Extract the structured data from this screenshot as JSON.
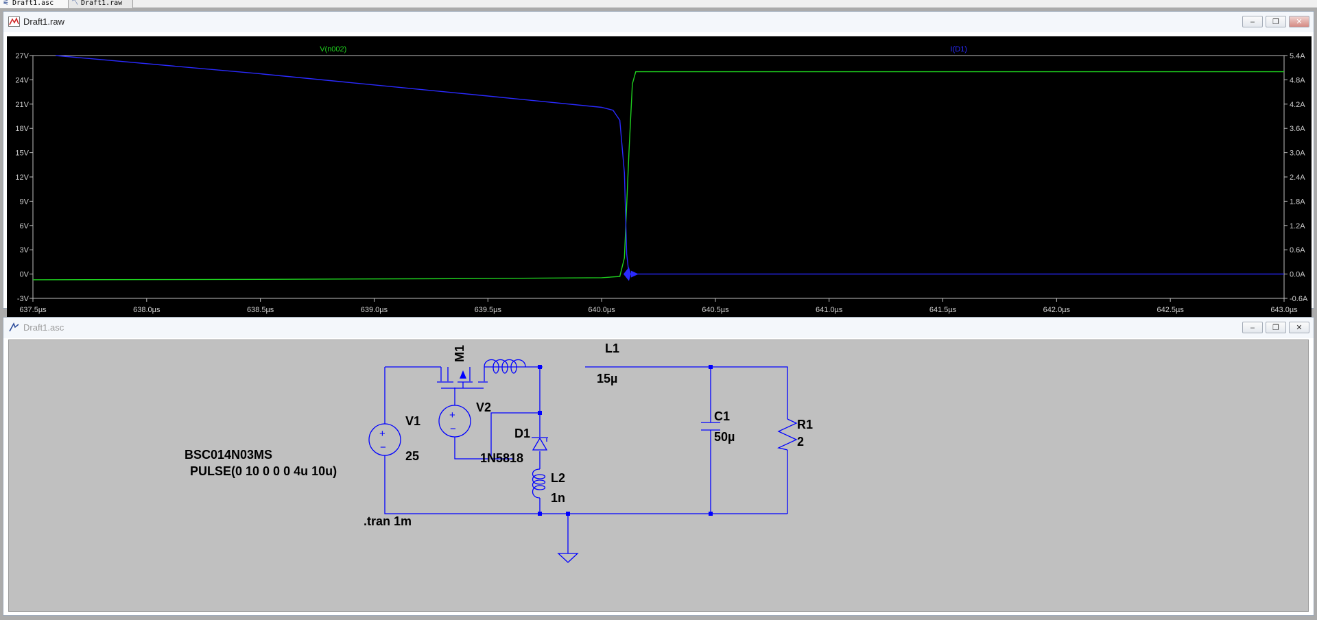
{
  "tabs": [
    {
      "label": "Draft1.asc",
      "icon": "schematic-icon"
    },
    {
      "label": "Draft1.raw",
      "icon": "waveform-icon"
    }
  ],
  "waveform_window": {
    "title": "Draft1.raw",
    "buttons": {
      "minimize": "‒",
      "restore": "❐",
      "close": "✕"
    }
  },
  "schematic_window": {
    "title": "Draft1.asc",
    "buttons": {
      "minimize": "‒",
      "restore": "❐",
      "close": "✕"
    }
  },
  "colors": {
    "plot_bg": "#000000",
    "trace_voltage": "#1fd21f",
    "trace_current": "#2a2aff",
    "wire": "#0000ff",
    "schematic_bg": "#c0c0c0"
  },
  "chart_data": {
    "type": "line",
    "x": {
      "ticks": [
        "637.5µs",
        "638.0µs",
        "638.5µs",
        "639.0µs",
        "639.5µs",
        "640.0µs",
        "640.5µs",
        "641.0µs",
        "641.5µs",
        "642.0µs",
        "642.5µs",
        "643.0µs"
      ],
      "tick_values": [
        637.5,
        638.0,
        638.5,
        639.0,
        639.5,
        640.0,
        640.5,
        641.0,
        641.5,
        642.0,
        642.5,
        643.0
      ],
      "range": [
        637.5,
        643.0
      ]
    },
    "y_left": {
      "ticks": [
        "27V",
        "24V",
        "21V",
        "18V",
        "15V",
        "12V",
        "9V",
        "6V",
        "3V",
        "0V",
        "-3V"
      ],
      "tick_values": [
        27,
        24,
        21,
        18,
        15,
        12,
        9,
        6,
        3,
        0,
        -3
      ],
      "range": [
        -3,
        27
      ]
    },
    "y_right": {
      "ticks": [
        "5.4A",
        "4.8A",
        "4.2A",
        "3.6A",
        "3.0A",
        "2.4A",
        "1.8A",
        "1.2A",
        "0.6A",
        "0.0A",
        "-0.6A"
      ],
      "tick_values": [
        5.4,
        4.8,
        4.2,
        3.6,
        3.0,
        2.4,
        1.8,
        1.2,
        0.6,
        0.0,
        -0.6
      ],
      "range": [
        -0.6,
        5.4
      ]
    },
    "series": [
      {
        "name": "V(n002)",
        "axis": "left",
        "color": "#1fd21f",
        "points": [
          [
            637.5,
            -0.7
          ],
          [
            638.5,
            -0.65
          ],
          [
            639.5,
            -0.55
          ],
          [
            640.0,
            -0.45
          ],
          [
            640.08,
            -0.3
          ],
          [
            640.1,
            2
          ],
          [
            640.12,
            15
          ],
          [
            640.135,
            23.5
          ],
          [
            640.15,
            25.0
          ],
          [
            643.0,
            25.0
          ]
        ]
      },
      {
        "name": "I(D1)",
        "axis": "right",
        "color": "#2a2aff",
        "points": [
          [
            637.6,
            5.4
          ],
          [
            638.5,
            4.95
          ],
          [
            639.5,
            4.4
          ],
          [
            640.0,
            4.12
          ],
          [
            640.05,
            4.05
          ],
          [
            640.08,
            3.8
          ],
          [
            640.1,
            2.5
          ],
          [
            640.11,
            0.5
          ],
          [
            640.12,
            0.0
          ],
          [
            643.0,
            0.0
          ]
        ]
      }
    ]
  },
  "schematic": {
    "components": {
      "M1": {
        "label": "M1",
        "model": "BSC014N03MS"
      },
      "V1": {
        "label": "V1",
        "value": "25"
      },
      "V2": {
        "label": "V2",
        "value": "PULSE(0 10 0 0 0 4u 10u)"
      },
      "D1": {
        "label": "D1",
        "model": "1N5818"
      },
      "L1": {
        "label": "L1",
        "value": "15µ"
      },
      "L2": {
        "label": "L2",
        "value": "1n"
      },
      "C1": {
        "label": "C1",
        "value": "50µ"
      },
      "R1": {
        "label": "R1",
        "value": "2"
      }
    },
    "directive": ".tran 1m",
    "source_symbols": {
      "plus": "+",
      "minus": "−"
    }
  }
}
